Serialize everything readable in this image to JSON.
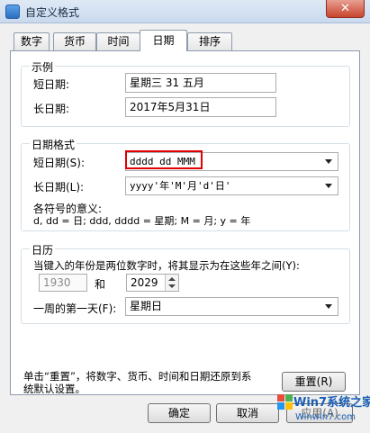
{
  "window": {
    "title": "自定义格式",
    "close": "✕"
  },
  "tabs": [
    "数字",
    "货币",
    "时间",
    "日期",
    "排序"
  ],
  "example": {
    "title": "示例",
    "short_label": "短日期:",
    "short_value": "星期三 31 五月",
    "long_label": "长日期:",
    "long_value": "2017年5月31日"
  },
  "date_format": {
    "title": "日期格式",
    "short_label": "短日期(S):",
    "short_value": "dddd dd MMM",
    "long_label": "长日期(L):",
    "long_value": "yyyy'年'M'月'd'日'",
    "legend_title": "各符号的意义:",
    "legend_text": "d, dd = 日;  ddd, dddd = 星期;  M = 月;  y = 年"
  },
  "calendar": {
    "title": "日历",
    "twodigit_text": "当键入的年份是两位数字时，将其显示为在这些年之间(Y):",
    "from_year": "1930",
    "and_label": "和",
    "to_year": "2029",
    "first_day_label": "一周的第一天(F):",
    "first_day_value": "星期日"
  },
  "footer": {
    "reset_text_line1": "单击“重置”，将数字、货币、时间和日期还原到系",
    "reset_text_line2": "统默认设置。",
    "reset_button": "重置(R)",
    "ok_button": "确定",
    "cancel_button": "取消",
    "apply_button": "应用(A)"
  },
  "watermark": {
    "brand": "Win7系统之家",
    "url": "Winwin7.com"
  }
}
